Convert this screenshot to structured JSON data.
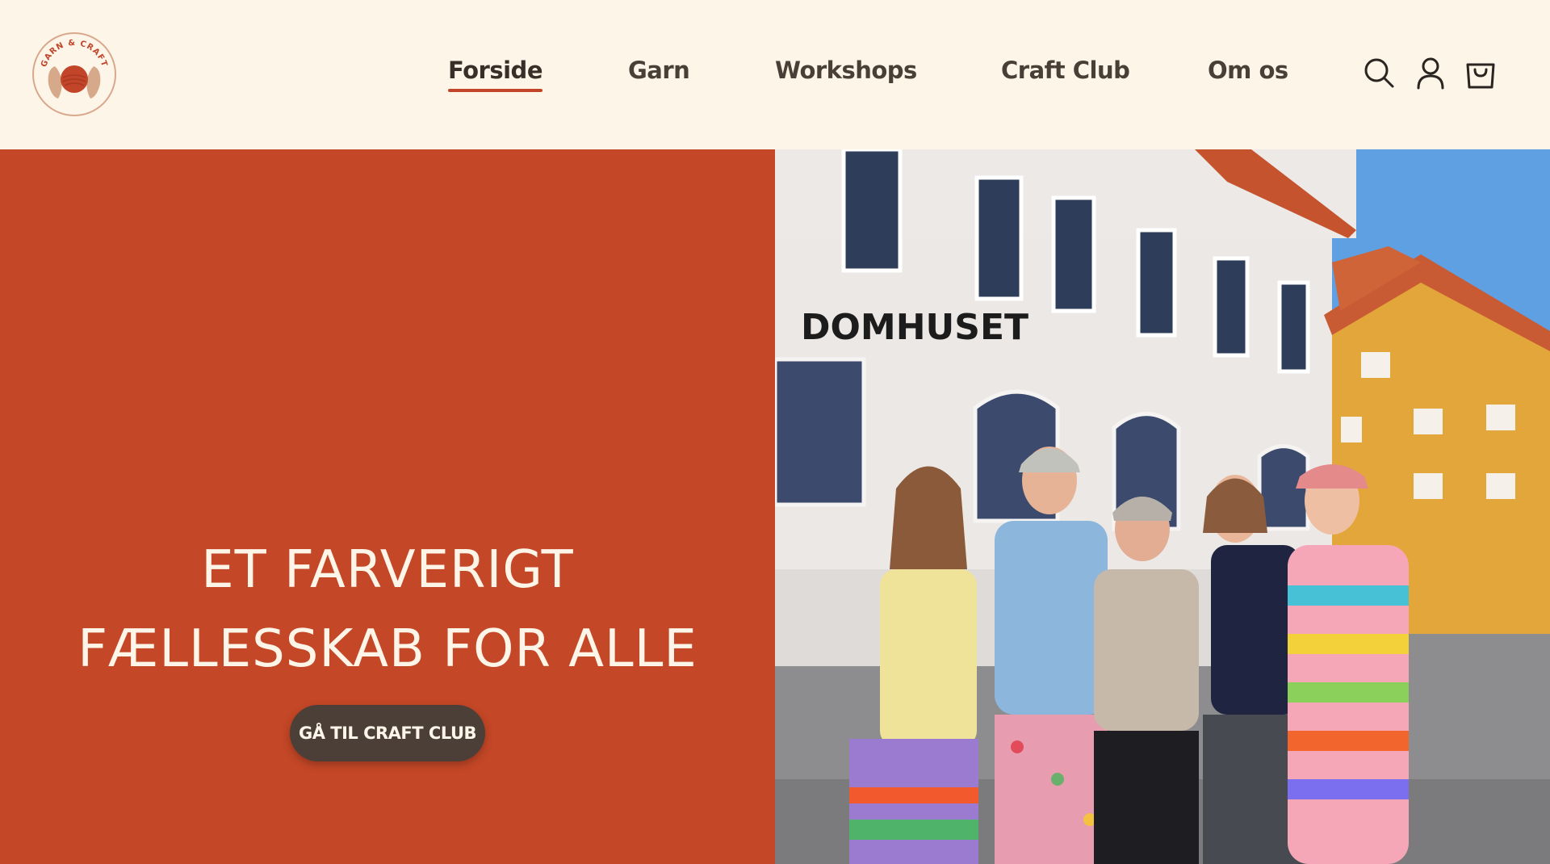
{
  "brand": {
    "logo_text": "GARN & CRAFT",
    "colors": {
      "cream": "#fdf5e8",
      "terracotta": "#c44727",
      "dark_brown": "#4b3f38"
    }
  },
  "nav": {
    "items": [
      {
        "label": "Forside",
        "active": true
      },
      {
        "label": "Garn",
        "active": false
      },
      {
        "label": "Workshops",
        "active": false
      },
      {
        "label": "Craft Club",
        "active": false
      },
      {
        "label": "Om os",
        "active": false
      }
    ]
  },
  "header_icons": [
    "search-icon",
    "account-icon",
    "cart-icon"
  ],
  "hero": {
    "title": "ET FARVERIGT\nFÆLLESSKAB FOR ALLE",
    "cta_label": "GÅ TIL CRAFT CLUB",
    "photo": {
      "sign_text": "DOMHUSET"
    }
  }
}
